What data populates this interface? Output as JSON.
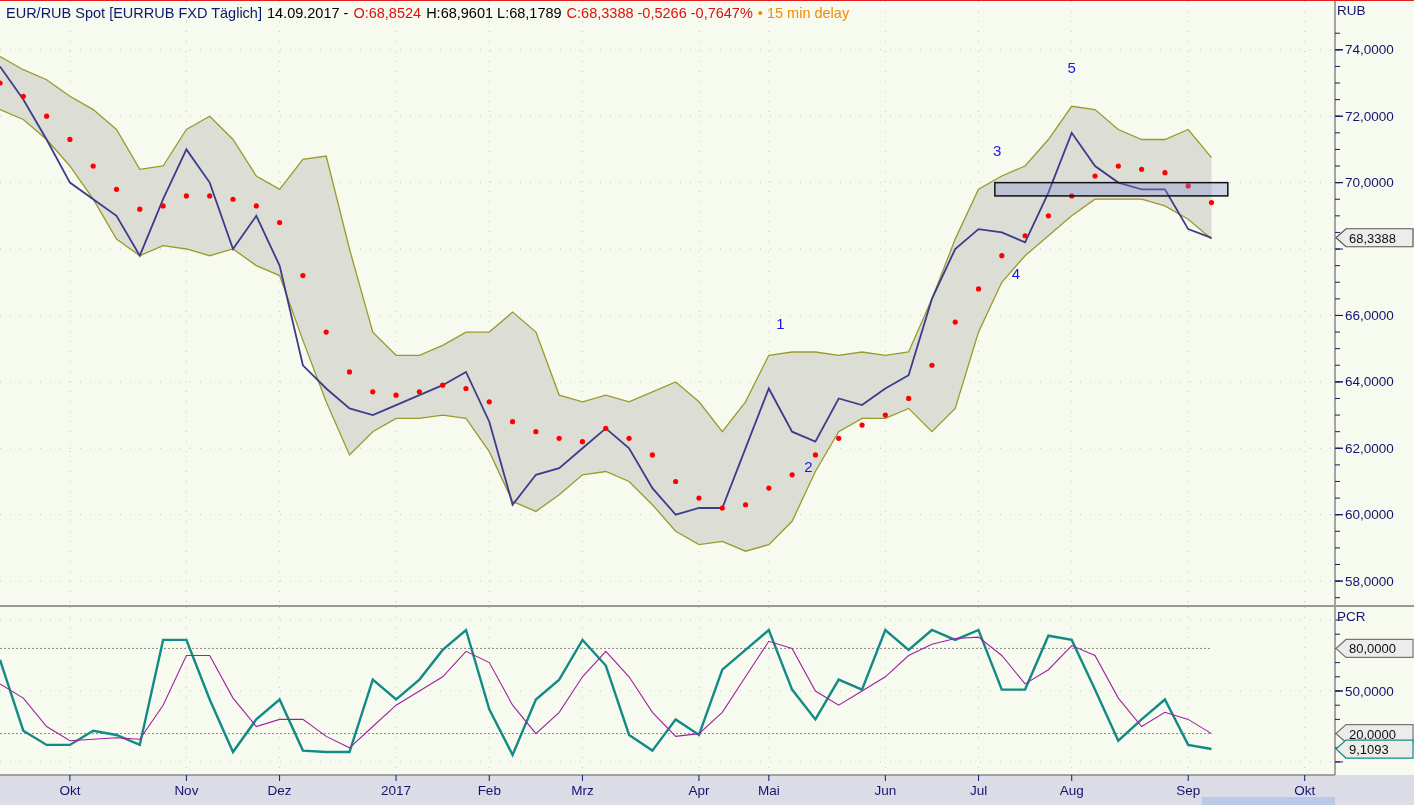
{
  "header": {
    "segments": [
      {
        "text": "EUR/RUB Spot [EURRUB FXD Täglich]",
        "color": "#0a1a6e"
      },
      {
        "text": "14.09.2017 -",
        "color": "#000000"
      },
      {
        "text": "O:68,8524",
        "color": "#e01010"
      },
      {
        "text": "H:68,9601 L:68,1789",
        "color": "#000000"
      },
      {
        "text": "C:68,3388 -0,5266 -0,7647%",
        "color": "#e01010"
      },
      {
        "text": "• 15 min delay",
        "color": "#f08c00"
      }
    ]
  },
  "price_chart": {
    "unit": "RUB",
    "axis_labels": [
      "74,0000",
      "72,0000",
      "70,0000",
      "66,0000",
      "64,0000",
      "62,0000",
      "60,0000",
      "58,0000"
    ],
    "wave_labels": [
      "1",
      "2",
      "3",
      "4",
      "5"
    ],
    "price_tag": "68,3388"
  },
  "indicator_chart": {
    "unit": "PCR",
    "axis_labels": [
      "50,0000"
    ],
    "level_tags": [
      "80,0000",
      "20,0000"
    ],
    "value_tag": "9,1093",
    "time_axis": [
      "Okt",
      "Nov",
      "Dez",
      "2017",
      "Feb",
      "Mrz",
      "Apr",
      "Mai",
      "Jun",
      "Jul",
      "Aug",
      "Sep",
      "Okt"
    ]
  }
}
